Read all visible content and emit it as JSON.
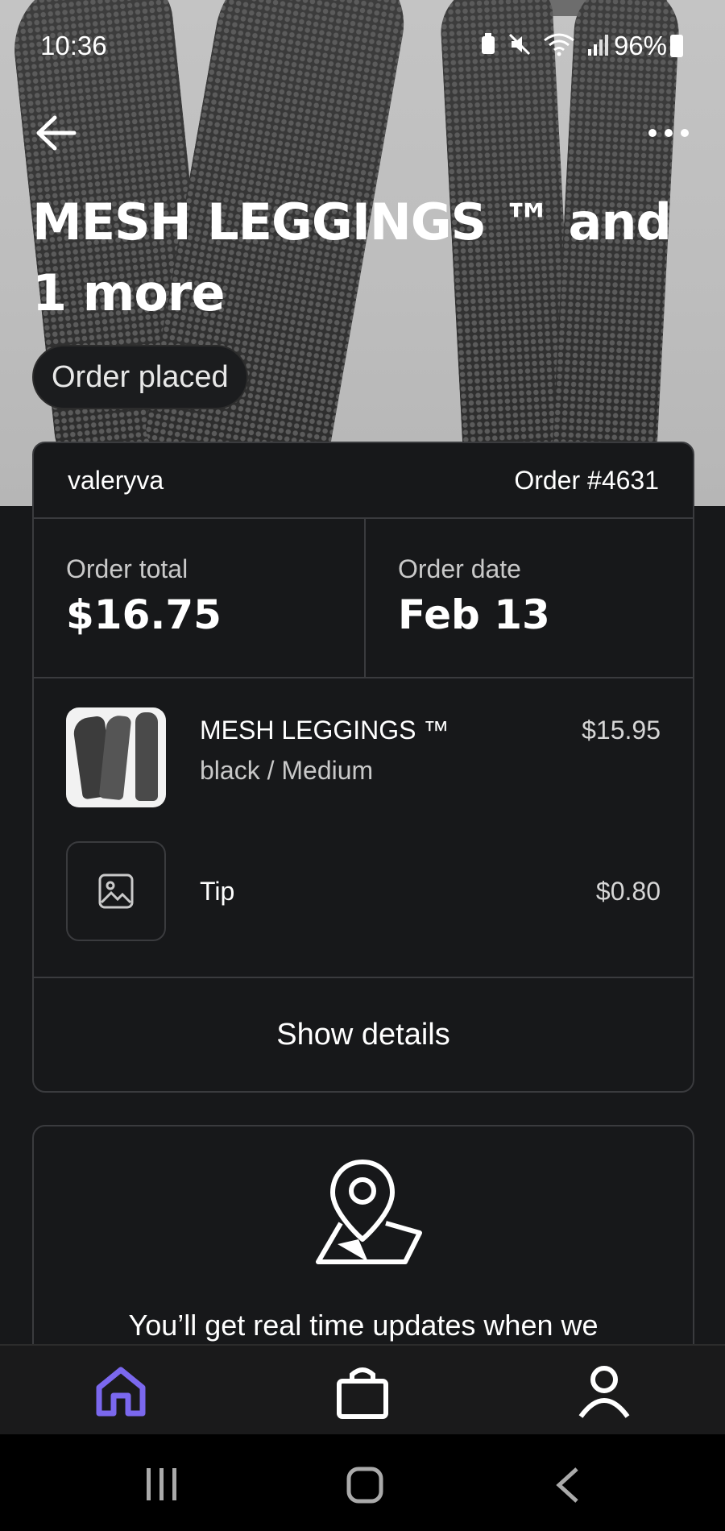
{
  "status_bar": {
    "time": "10:36",
    "battery": "96%"
  },
  "header": {
    "title": "MESH LEGGINGS ™ and 1 more",
    "status_pill": "Order placed"
  },
  "order": {
    "customer": "valeryva",
    "order_number": "Order #4631",
    "total_label": "Order total",
    "total_value": "$16.75",
    "date_label": "Order date",
    "date_value": "Feb 13",
    "items": [
      {
        "name": "MESH LEGGINGS ™",
        "variant": "black / Medium",
        "price": "$15.95"
      },
      {
        "name": "Tip",
        "variant": "",
        "price": "$0.80"
      }
    ],
    "show_details": "Show details"
  },
  "tracking": {
    "message": "You’ll get real time updates when we"
  },
  "colors": {
    "accent": "#7b68ee",
    "background": "#17181a",
    "border": "#3a3b3e"
  },
  "bottom_nav": {
    "active": "home"
  }
}
